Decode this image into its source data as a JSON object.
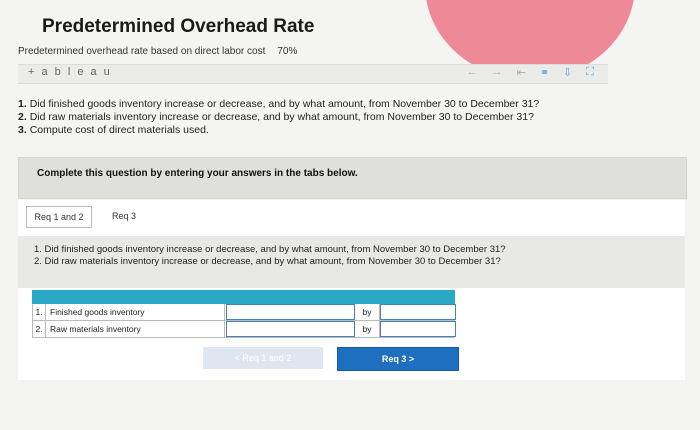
{
  "page_title": "Predetermined Overhead Rate",
  "viz": {
    "label": "Predetermined overhead rate based on direct labor cost",
    "percent": "70%"
  },
  "tableau": {
    "logo": "+ a b l e a u"
  },
  "questions": [
    {
      "num": "1.",
      "text": "Did finished goods inventory increase or decrease, and by what amount, from November 30 to December 31?"
    },
    {
      "num": "2.",
      "text": "Did raw materials inventory increase or decrease, and by what amount, from November 30 to December 31?"
    },
    {
      "num": "3.",
      "text": "Compute cost of direct materials used."
    }
  ],
  "complete_prompt": "Complete this question by entering your answers in the tabs below.",
  "tabs": [
    {
      "label": "Req 1 and 2"
    },
    {
      "label": "Req 3"
    }
  ],
  "inner_questions": [
    "1. Did finished goods inventory increase or decrease, and by what amount, from November 30 to December 31?",
    "2. Did raw materials inventory increase or decrease, and by what amount, from November 30 to December 31?"
  ],
  "table": {
    "rows": [
      {
        "num": "1.",
        "label": "Finished goods inventory",
        "by": "by"
      },
      {
        "num": "2.",
        "label": "Raw materials inventory",
        "by": "by"
      }
    ]
  },
  "buttons": {
    "prev": "< Req 1 and 2",
    "next": "Req 3  >"
  },
  "colors": {
    "accent": "#1f6fc0",
    "table_header": "#2aa9c6",
    "circle": "#ee8a98"
  }
}
